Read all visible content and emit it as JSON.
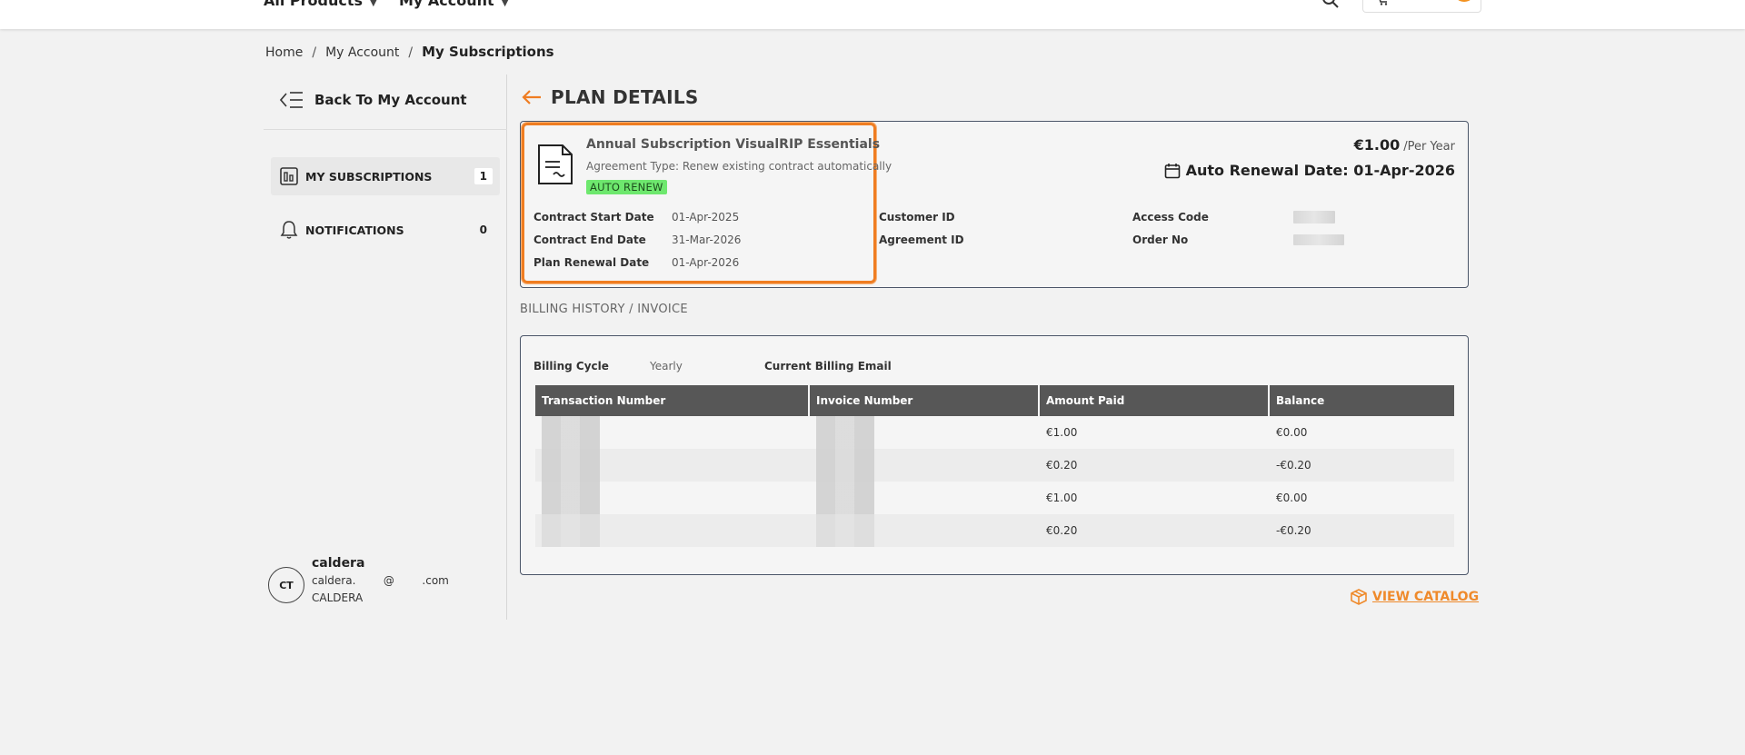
{
  "header": {
    "nav_products": "All Products",
    "nav_account": "My Account"
  },
  "breadcrumb": {
    "home": "Home",
    "account": "My Account",
    "current": "My Subscriptions"
  },
  "sidebar": {
    "back_label": "Back To My Account",
    "items": [
      {
        "label": "MY SUBSCRIPTIONS",
        "count": "1",
        "active": true
      },
      {
        "label": "NOTIFICATIONS",
        "count": "0",
        "active": false
      }
    ],
    "user": {
      "initials": "CT",
      "name": "caldera",
      "email": "caldera.        @        .com",
      "org": "CALDERA"
    }
  },
  "plan": {
    "title": "PLAN DETAILS",
    "subscription_name": "Annual Subscription VisualRIP Essentials",
    "agreement_type": "Agreement Type: Renew existing contract automatically",
    "badge": "AUTO RENEW",
    "contract_start_label": "Contract Start Date",
    "contract_start_value": "01-Apr-2025",
    "contract_end_label": "Contract End Date",
    "contract_end_value": "31-Mar-2026",
    "plan_renewal_label": "Plan Renewal Date",
    "plan_renewal_value": "01-Apr-2026",
    "customer_id_label": "Customer ID",
    "agreement_id_label": "Agreement ID",
    "access_code_label": "Access Code",
    "order_no_label": "Order No",
    "price": "€1.00",
    "price_period": "/Per Year",
    "auto_renewal": "Auto Renewal Date: 01-Apr-2026"
  },
  "billing": {
    "title": "BILLING HISTORY / INVOICE",
    "cycle_label": "Billing Cycle",
    "cycle_value": "Yearly",
    "email_label": "Current Billing Email",
    "columns": [
      "Transaction Number",
      "Invoice Number",
      "Amount Paid",
      "Balance"
    ],
    "rows": [
      {
        "amount": "€1.00",
        "balance": "€0.00"
      },
      {
        "amount": "€0.20",
        "balance": "-€0.20"
      },
      {
        "amount": "€1.00",
        "balance": "€0.00"
      },
      {
        "amount": "€0.20",
        "balance": "-€0.20"
      }
    ]
  },
  "footer": {
    "view_catalog": "VIEW CATALOG"
  },
  "colors": {
    "accent": "#ef7d22",
    "badge_green": "#6ee86e",
    "table_header": "#575757",
    "border": "#4b5669"
  }
}
